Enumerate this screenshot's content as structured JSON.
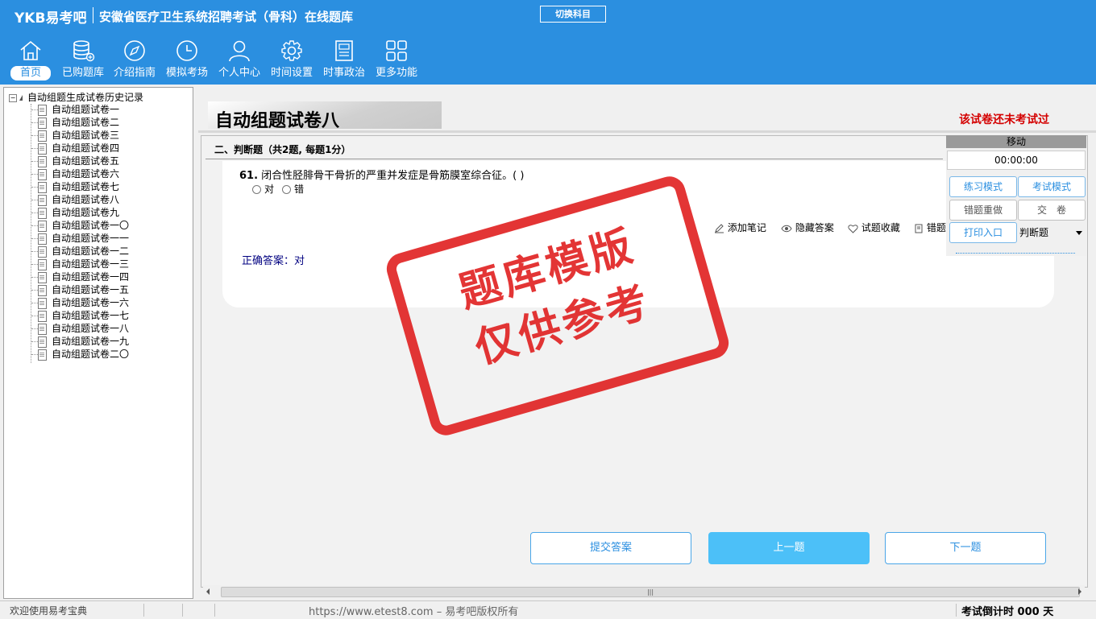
{
  "header": {
    "logo": "YKB易考吧",
    "app_title": "安徽省医疗卫生系统招聘考试（骨科）在线题库",
    "switch_subject": "切换科目",
    "nav": [
      {
        "label": "首页",
        "icon": "home-icon"
      },
      {
        "label": "已购题库",
        "icon": "database-icon"
      },
      {
        "label": "介绍指南",
        "icon": "compass-icon"
      },
      {
        "label": "模拟考场",
        "icon": "clock-icon"
      },
      {
        "label": "个人中心",
        "icon": "user-icon"
      },
      {
        "label": "时间设置",
        "icon": "gear-icon"
      },
      {
        "label": "时事政治",
        "icon": "newspaper-icon"
      },
      {
        "label": "更多功能",
        "icon": "grid-icon"
      }
    ]
  },
  "tree": {
    "root": "自动组题生成试卷历史记录",
    "items": [
      "自动组题试卷一",
      "自动组题试卷二",
      "自动组题试卷三",
      "自动组题试卷四",
      "自动组题试卷五",
      "自动组题试卷六",
      "自动组题试卷七",
      "自动组题试卷八",
      "自动组题试卷九",
      "自动组题试卷一〇",
      "自动组题试卷一一",
      "自动组题试卷一二",
      "自动组题试卷一三",
      "自动组题试卷一四",
      "自动组题试卷一五",
      "自动组题试卷一六",
      "自动组题试卷一七",
      "自动组题试卷一八",
      "自动组题试卷一九",
      "自动组题试卷二〇"
    ]
  },
  "main": {
    "paper_title": "自动组题试卷八",
    "not_taken": "该试卷还未考试过",
    "section": "二、判断题（共2题, 每题1分）",
    "question": {
      "number": "61.",
      "text": "闭合性胫腓骨干骨折的严重并发症是骨筋膜室综合征。( )",
      "options": [
        "对",
        "错"
      ],
      "answer": "正确答案：对"
    },
    "tools": [
      "添加笔记",
      "隐藏答案",
      "试题收藏",
      "错题"
    ],
    "stamp": [
      "题库模版",
      "仅供参考"
    ],
    "buttons": {
      "submit": "提交答案",
      "prev": "上一题",
      "next": "下一题"
    }
  },
  "panel": {
    "title": "移动",
    "timer": "00:00:00",
    "practice": "练习模式",
    "exam": "考试模式",
    "redo_wrong": "错题重做",
    "hand_in": "交　卷",
    "print": "打印入口",
    "qtype": "判断题"
  },
  "status": {
    "welcome": "欢迎使用易考宝典",
    "copyright": "https://www.etest8.com – 易考吧版权所有",
    "countdown": "考试倒计时 000 天"
  },
  "colors": {
    "header": "#2b8fe0",
    "accent_red": "#d40000",
    "button_blue": "#4cc0f8"
  }
}
